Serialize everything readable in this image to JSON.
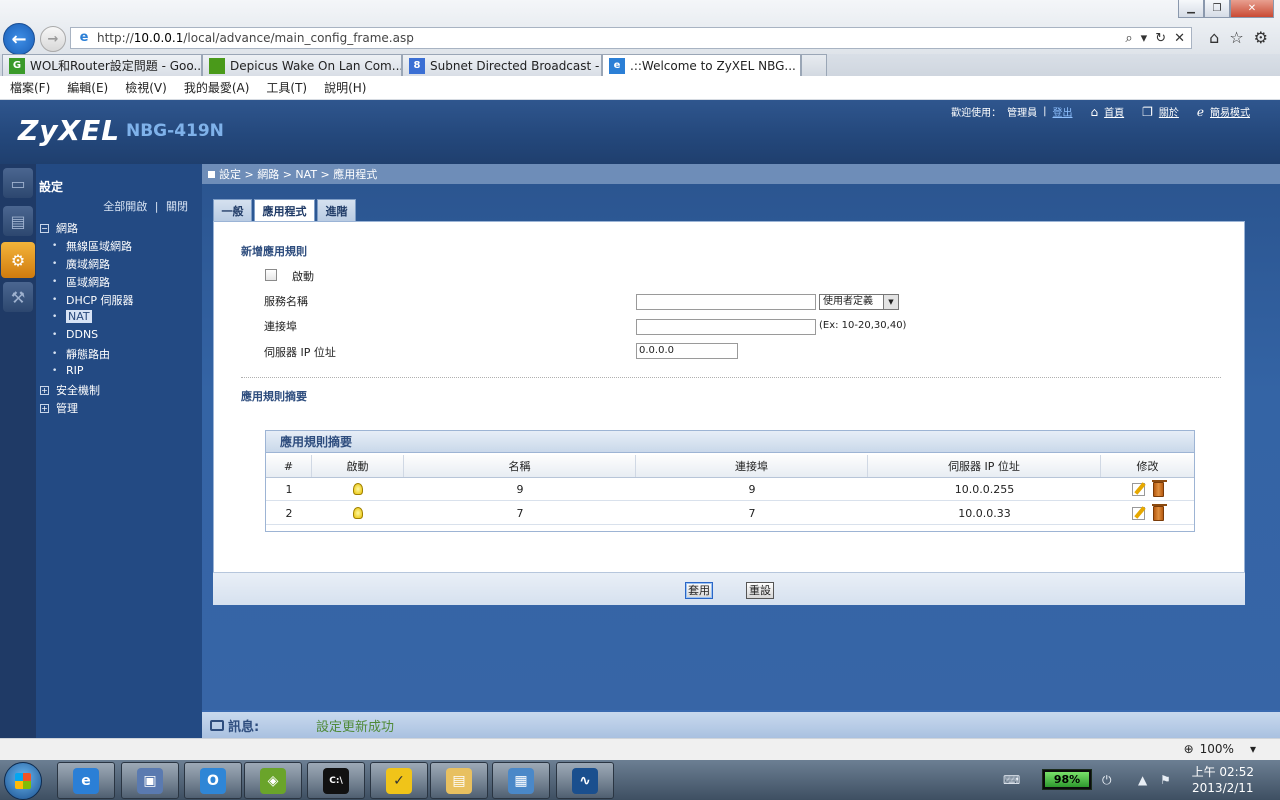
{
  "browser": {
    "url_prefix": "http://",
    "url_host": "10.0.0.1",
    "url_path": "/local/advance/main_config_frame.asp",
    "tabs": [
      {
        "title": "WOL和Router設定問題 - Goo...",
        "favicon_color": "#3a9a2a",
        "favicon_label": "G"
      },
      {
        "title": "Depicus Wake On Lan Com...",
        "favicon_color": "#4a9a1a",
        "favicon_label": ""
      },
      {
        "title": "Subnet Directed Broadcast - ...",
        "favicon_color": "#3b6fd4",
        "favicon_label": "8"
      },
      {
        "title": ".::Welcome to ZyXEL NBG...",
        "favicon_color": "#2b7fd6",
        "favicon_label": "e"
      }
    ],
    "tab_close": "✕",
    "menu": [
      "檔案(F)",
      "編輯(E)",
      "檢視(V)",
      "我的最愛(A)",
      "工具(T)",
      "說明(H)"
    ],
    "zoom": "100%"
  },
  "router": {
    "brand": "ZyXEL",
    "model": "NBG-419N",
    "welcome": "歡迎使用：",
    "user": "管理員",
    "logout": "登出",
    "links": {
      "home": "首頁",
      "about": "關於",
      "easy_mode": "簡易模式"
    },
    "icons": {
      "home": "home-icon",
      "about": "about-icon",
      "easy": "easy-mode-icon"
    }
  },
  "sidebar": {
    "title": "設定",
    "expand_all": "全部開啟",
    "separator": "|",
    "collapse_all": "關閉",
    "groups": [
      {
        "label": "網路",
        "expanded": true,
        "symbol": "−"
      },
      {
        "label": "安全機制",
        "expanded": false,
        "symbol": "+"
      },
      {
        "label": "管理",
        "expanded": false,
        "symbol": "+"
      }
    ],
    "network_items": [
      "無線區域網路",
      "廣域網路",
      "區域網路",
      "DHCP 伺服器",
      "NAT",
      "DDNS",
      "靜態路由",
      "RIP"
    ],
    "selected": "NAT"
  },
  "breadcrumb": "設定 > 網路 > NAT > 應用程式",
  "tabs": [
    "一般",
    "應用程式",
    "進階"
  ],
  "active_tab": "應用程式",
  "form": {
    "section_new": "新增應用規則",
    "enable_label": "啟動",
    "service_name_label": "服務名稱",
    "service_name_value": "",
    "service_select": "使用者定義",
    "port_label": "連接埠",
    "port_value": "",
    "port_hint": "(Ex: 10-20,30,40)",
    "server_ip_label": "伺服器 IP 位址",
    "server_ip_value": "0.0.0.0",
    "section_summary": "應用規則摘要"
  },
  "summary_table": {
    "title": "應用規則摘要",
    "columns": [
      "#",
      "啟動",
      "名稱",
      "連接埠",
      "伺服器 IP 位址",
      "修改"
    ],
    "rows": [
      {
        "num": "1",
        "enabled": true,
        "name": "9",
        "port": "9",
        "ip": "10.0.0.255"
      },
      {
        "num": "2",
        "enabled": true,
        "name": "7",
        "port": "7",
        "ip": "10.0.0.33"
      }
    ]
  },
  "buttons": {
    "apply": "套用",
    "reset": "重設"
  },
  "status": {
    "label": "訊息:",
    "message": "設定更新成功"
  },
  "taskbar": {
    "battery": "98%",
    "time": "上午 02:52",
    "date": "2013/2/11",
    "apps": [
      "ie-icon",
      "network-icon",
      "outlook-icon",
      "vmware-icon",
      "cmd-icon",
      "kingsoft-icon",
      "explorer-icon",
      "remote-desktop-icon",
      "wireshark-icon"
    ]
  }
}
